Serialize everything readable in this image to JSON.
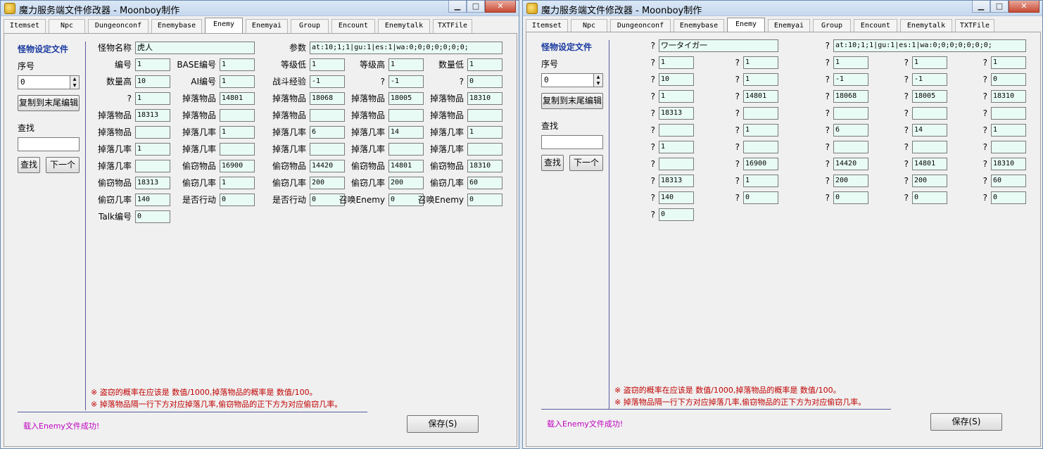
{
  "left": {
    "title": "魔力服务端文件修改器 - Moonboy制作",
    "tabs": [
      "Itemset",
      "Npc",
      "Dungeonconf",
      "Enemybase",
      "Enemy",
      "Enemyai",
      "Group",
      "Encount",
      "Enemytalk",
      "TXTFile"
    ],
    "active_tab": "Enemy",
    "side_title": "怪物设定文件",
    "index_label": "序号",
    "index_value": "0",
    "copy_button": "复制到末尾编辑",
    "search_label": "查找",
    "search_value": "",
    "find_button": "查找",
    "next_button": "下一个",
    "name_label": "怪物名称",
    "name_value": "虎人",
    "param_label": "参数",
    "param_value": "at:10;1;1|gu:1|es:1|wa:0;0;0;0;0;0;0;",
    "grid_labels": [
      [
        "编号",
        "BASE编号",
        "等级低",
        "等级高",
        "数量低"
      ],
      [
        "数量高",
        "AI编号",
        "战斗经验",
        "?",
        "?"
      ],
      [
        "?",
        "掉落物品",
        "掉落物品",
        "掉落物品",
        "掉落物品"
      ],
      [
        "掉落物品",
        "掉落物品",
        "掉落物品",
        "掉落物品",
        "掉落物品"
      ],
      [
        "掉落物品",
        "掉落几率",
        "掉落几率",
        "掉落几率",
        "掉落几率"
      ],
      [
        "掉落几率",
        "掉落几率",
        "掉落几率",
        "掉落几率",
        "掉落几率"
      ],
      [
        "掉落几率",
        "偷窃物品",
        "偷窃物品",
        "偷窃物品",
        "偷窃物品"
      ],
      [
        "偷窃物品",
        "偷窃几率",
        "偷窃几率",
        "偷窃几率",
        "偷窃几率"
      ],
      [
        "偷窃几率",
        "是否行动",
        "是否行动",
        "召唤Enemy",
        "召唤Enemy"
      ],
      [
        "Talk编号"
      ]
    ],
    "grid_values": [
      [
        "1",
        "1",
        "1",
        "1",
        "1"
      ],
      [
        "10",
        "1",
        "-1",
        "-1",
        "0"
      ],
      [
        "1",
        "14801",
        "18068",
        "18005",
        "18310"
      ],
      [
        "18313",
        "",
        "",
        "",
        ""
      ],
      [
        "",
        "1",
        "6",
        "14",
        "1"
      ],
      [
        "1",
        "",
        "",
        "",
        ""
      ],
      [
        "",
        "16900",
        "14420",
        "14801",
        "18310"
      ],
      [
        "18313",
        "1",
        "200",
        "200",
        "60"
      ],
      [
        "140",
        "0",
        "0",
        "0",
        "0"
      ],
      [
        "0"
      ]
    ],
    "note1": "※ 盗窃的概率在应该是 数值/1000,掉落物品的概率是 数值/100。",
    "note2": "※ 掉落物品隔一行下方对应掉落几率,偷窃物品的正下方为对应偷窃几率。",
    "status": "载入Enemy文件成功!",
    "save_button": "保存(S)"
  },
  "right": {
    "title": "魔力服务端文件修改器 - Moonboy制作",
    "tabs": [
      "Itemset",
      "Npc",
      "Dungeonconf",
      "Enemybase",
      "Enemy",
      "Enemyai",
      "Group",
      "Encount",
      "Enemytalk",
      "TXTFile"
    ],
    "active_tab": "Enemy",
    "side_title": "怪物设定文件",
    "index_label": "序号",
    "index_value": "0",
    "copy_button": "复制到末尾编辑",
    "search_label": "查找",
    "search_value": "",
    "find_button": "查找",
    "next_button": "下一个",
    "name_label": "?",
    "name_value": "ワ一タイガ一",
    "param_label": "?",
    "param_value": "at:10;1;1|gu:1|es:1|wa:0;0;0;0;0;0;0;",
    "grid_labels": [
      [
        "?",
        "?",
        "?",
        "?",
        "?"
      ],
      [
        "?",
        "?",
        "?",
        "?",
        "?"
      ],
      [
        "?",
        "?",
        "?",
        "?",
        "?"
      ],
      [
        "?",
        "?",
        "?",
        "?",
        "?"
      ],
      [
        "?",
        "?",
        "?",
        "?",
        "?"
      ],
      [
        "?",
        "?",
        "?",
        "?",
        "?"
      ],
      [
        "?",
        "?",
        "?",
        "?",
        "?"
      ],
      [
        "?",
        "?",
        "?",
        "?",
        "?"
      ],
      [
        "?",
        "?",
        "?",
        "?",
        "?"
      ],
      [
        "?"
      ]
    ],
    "grid_values": [
      [
        "1",
        "1",
        "1",
        "1",
        "1"
      ],
      [
        "10",
        "1",
        "-1",
        "-1",
        "0"
      ],
      [
        "1",
        "14801",
        "18068",
        "18005",
        "18310"
      ],
      [
        "18313",
        "",
        "",
        "",
        ""
      ],
      [
        "",
        "1",
        "6",
        "14",
        "1"
      ],
      [
        "1",
        "",
        "",
        "",
        ""
      ],
      [
        "",
        "16900",
        "14420",
        "14801",
        "18310"
      ],
      [
        "18313",
        "1",
        "200",
        "200",
        "60"
      ],
      [
        "140",
        "0",
        "0",
        "0",
        "0"
      ],
      [
        "0"
      ]
    ],
    "note1": "※ 盗窃的概率在应该是 数值/1000,掉落物品的概率是 数值/100。",
    "note2": "※ 掉落物品隔一行下方对应掉落几率,偷窃物品的正下方为对应偷窃几率。",
    "status": "载入Enemy文件成功!",
    "save_button": "保存(S)"
  }
}
